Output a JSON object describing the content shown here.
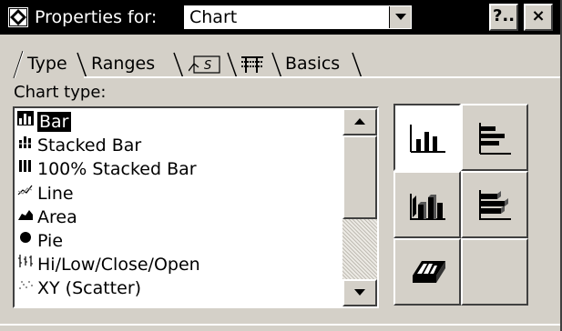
{
  "titlebar": {
    "label": "Properties for:",
    "object_value": "Chart",
    "help_button": "?..",
    "close_button": "×"
  },
  "tabs": [
    {
      "label": "Type",
      "active": true
    },
    {
      "label": "Ranges"
    },
    {
      "label": "",
      "icon": "series-icon"
    },
    {
      "label": "",
      "icon": "gridlines-icon"
    },
    {
      "label": "Basics"
    }
  ],
  "chart_type": {
    "label": "Chart type:",
    "items": [
      {
        "label": "Bar",
        "icon": "bar-chart-icon",
        "selected": true
      },
      {
        "label": "Stacked Bar",
        "icon": "stacked-bar-icon"
      },
      {
        "label": "100% Stacked Bar",
        "icon": "full-stacked-bar-icon"
      },
      {
        "label": "Line",
        "icon": "line-chart-icon"
      },
      {
        "label": "Area",
        "icon": "area-chart-icon"
      },
      {
        "label": "Pie",
        "icon": "pie-chart-icon"
      },
      {
        "label": "Hi/Low/Close/Open",
        "icon": "hilow-chart-icon"
      },
      {
        "label": "XY (Scatter)",
        "icon": "scatter-chart-icon"
      }
    ]
  },
  "styles": [
    {
      "icon": "vertical-bar-style-icon",
      "selected": true
    },
    {
      "icon": "horizontal-bar-style-icon"
    },
    {
      "icon": "3d-vertical-bar-style-icon"
    },
    {
      "icon": "3d-horizontal-bar-style-icon"
    },
    {
      "icon": "3d-perspective-bar-style-icon"
    },
    {
      "icon": ""
    }
  ]
}
